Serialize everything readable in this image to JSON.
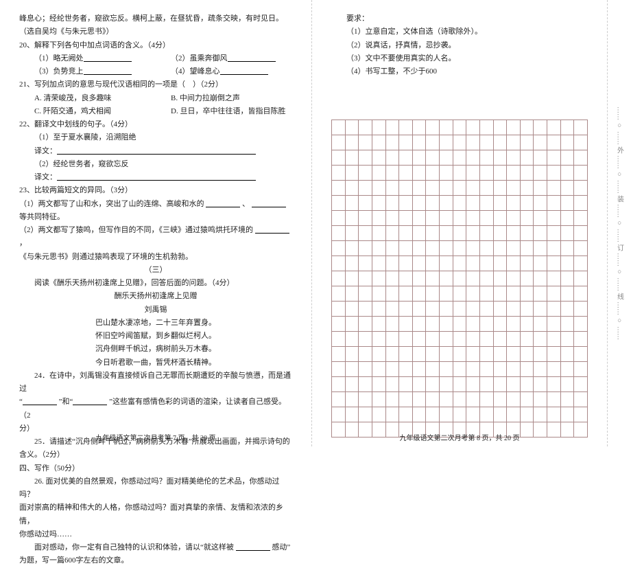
{
  "left": {
    "opening": "峰息心；经纶世务者，窥欲忘反。横柯上蔽，在昼犹昏，疏条交映，有时见日。（选自吴均《与朱元思书》）",
    "q20": "20、解释下列各句中加点词语的含义。（4分）",
    "q20a": "（1）略无阙处",
    "q20b": "（2）虽乘奔御风",
    "q20c": "（3）负势竞上",
    "q20d": "（4）望峰息心",
    "q21": "21、写列加点词的意思与现代汉语相同的一项是（　）（2分）",
    "q21a": "A. 清荣峻茂，良多趣味",
    "q21b": "B. 中间力拉崩倒之声",
    "q21c": "C. 阡陌交通，鸡犬相闻",
    "q21d": "D. 旦日，卒中往往语，皆指目陈胜",
    "q22": "22、翻译文中划线的句子。（4分）",
    "q22a": "（1）至于夏水襄陵，沿溯阻绝",
    "yiwena": "译文：",
    "q22b": "（2）经纶世务者，窥欲忘反",
    "yiwenb": "译文：",
    "q23": "23、比较两篇短文的异同。（3分）",
    "q23a1": "（1）两文都写了山和水，突出了山的连绵、高峻和水的",
    "q23a2": "、",
    "q23a3": "等共同特征。",
    "q23b1": "（2）两文都写了猿鸣，但写作目的不同，《三峡》通过猿鸣烘托环境的",
    "q23b2": "，",
    "q23c": "《与朱元思书》则通过猿鸣表现了环境的生机勃勃。",
    "san": "（三）",
    "readintro": "阅读《酬乐天扬州初逢席上见赠》，回答后面的问题。（4分）",
    "poemtitle": "酬乐天扬州初逢席上见赠",
    "poemauthor": "刘禹锡",
    "poem1": "巴山楚水凄凉地，二十三年弃置身。",
    "poem2": "怀旧空吟闻笛赋，到乡翻似烂柯人。",
    "poem3": "沉舟侧畔千帆过，病树前头万木春。",
    "poem4": "今日听君歌一曲，暂凭杯酒长精神。",
    "q24a": "24．在诗中，刘禹锡没有直接倾诉自己无罪而长期遭贬的辛酸与愤懑，而是通过",
    "q24b": "“",
    "q24c": "”和“",
    "q24d": "”这些富有感情色彩的词语的渲染，让读者自己感受。（2",
    "q24e": "分）",
    "q25a": "25．请描述“沉舟侧畔千帆过，病树前头万木春”所展现出画面，并揭示诗句的",
    "q25b": "含义。（2分）",
    "section4": "四、写作（50分）",
    "q26a": "26. 面对优美的自然景观，你感动过吗？面对精美绝伦的艺术品，你感动过吗？",
    "q26b": "面对崇高的精神和伟大的人格，你感动过吗？面对真挚的亲情、友情和浓浓的乡情，",
    "q26c": "你感动过吗……",
    "q26d1": "面对感动，你一定有自己独特的认识和体验，请以“就这样被",
    "q26d2": "感动”",
    "q26e": "为题，写一篇600字左右的文章。",
    "footer": "九年级语文第二次月考第 7 页，共 20 页"
  },
  "right": {
    "req": "要求：",
    "r1": "（1）立意自定，文体自选（诗歌除外）。",
    "r2": "（2）说真话，抒真情，忌抄袭。",
    "r3": "（3）文中不要使用真实的人名。",
    "r4": "（4）书写工整，不少于600",
    "footer": "九年级语文第二次月考第 8 页，共 20 页"
  },
  "side": "…… ○ …… 外 …… ○ …… 装 …… ○ …… 订 …… ○ …… 线 …… ○ ……"
}
